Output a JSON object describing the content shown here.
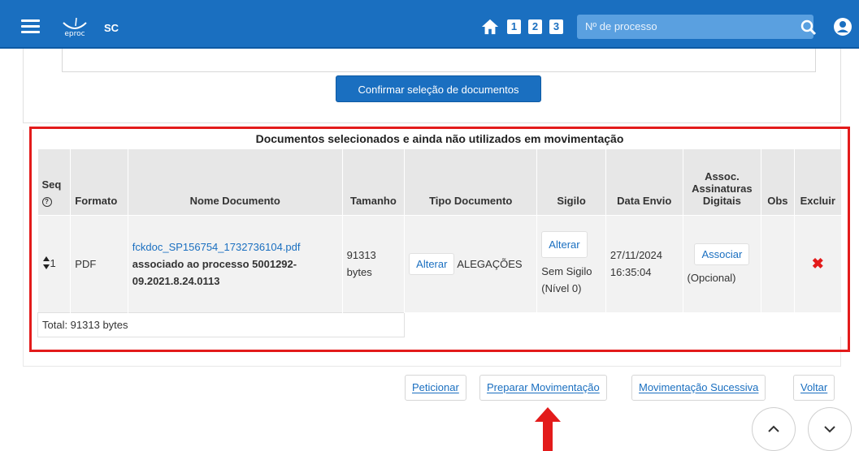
{
  "header": {
    "logo_text": "eproc",
    "state": "SC",
    "nav_numbers": [
      "1",
      "2",
      "3"
    ],
    "search_placeholder": "Nº de processo"
  },
  "confirm_button": "Confirmar seleção de documentos",
  "table": {
    "title": "Documentos selecionados e ainda não utilizados em movimentação",
    "headers": {
      "seq": "Seq",
      "seq_help": "?",
      "formato": "Formato",
      "nome": "Nome Documento",
      "tamanho": "Tamanho",
      "tipo": "Tipo Documento",
      "sigilo": "Sigilo",
      "data": "Data Envio",
      "assoc": "Assoc. Assinaturas Digitais",
      "obs": "Obs",
      "excluir": "Excluir"
    },
    "rows": [
      {
        "seq": "1",
        "formato": "PDF",
        "file_link": "fckdoc_SP156754_1732736104.pdf",
        "description": "associado ao processo 5001292-09.2021.8.24.0113",
        "tamanho": "91313 bytes",
        "tipo_button": "Alterar",
        "tipo": "ALEGAÇÕES",
        "sigilo_button": "Alterar",
        "sigilo": "Sem Sigilo (Nível 0)",
        "data": "27/11/2024 16:35:04",
        "assoc_button": "Associar",
        "assoc_note": "(Opcional)",
        "obs": "",
        "excluir": "✖"
      }
    ],
    "total": "Total: 91313 bytes"
  },
  "footer_buttons": {
    "peticionar": "Peticionar",
    "preparar": "Preparar Movimentação",
    "sucessiva": "Movimentação Sucessiva",
    "voltar": "Voltar"
  },
  "colors": {
    "brand": "#1a6fc0",
    "highlight": "#e31b1b"
  }
}
